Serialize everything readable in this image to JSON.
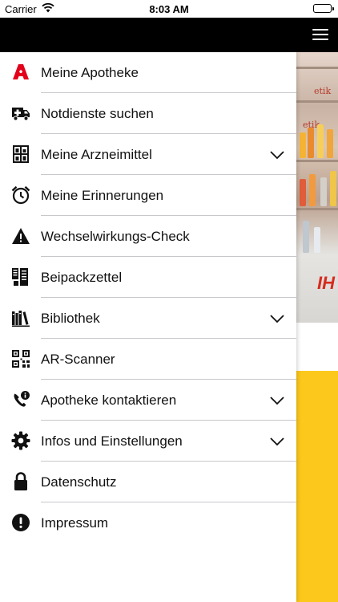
{
  "status_bar": {
    "carrier": "Carrier",
    "time": "8:03 AM",
    "battery_level": 1.0
  },
  "nav_bar": {
    "menu_icon": "hamburger-icon"
  },
  "background": {
    "brand_text_1": "etik",
    "brand_text_2": "etik",
    "promo_text": "IH",
    "accent_color": "#fcc81b"
  },
  "menu": {
    "items": [
      {
        "label": "Meine Apotheke",
        "icon": "pharmacy-icon",
        "icon_color": "#e3001b",
        "has_chevron": false
      },
      {
        "label": "Notdienste suchen",
        "icon": "ambulance-icon",
        "has_chevron": false
      },
      {
        "label": "Meine Arzneimittel",
        "icon": "medicine-cabinet-icon",
        "has_chevron": true
      },
      {
        "label": "Meine Erinnerungen",
        "icon": "alarm-clock-icon",
        "has_chevron": false
      },
      {
        "label": "Wechselwirkungs-Check",
        "icon": "warning-icon",
        "has_chevron": false
      },
      {
        "label": "Beipackzettel",
        "icon": "leaflet-icon",
        "has_chevron": false
      },
      {
        "label": "Bibliothek",
        "icon": "library-icon",
        "has_chevron": true
      },
      {
        "label": "AR-Scanner",
        "icon": "qr-code-icon",
        "has_chevron": false
      },
      {
        "label": "Apotheke kontaktieren",
        "icon": "phone-info-icon",
        "has_chevron": true
      },
      {
        "label": "Infos und Einstellungen",
        "icon": "gear-icon",
        "has_chevron": true
      },
      {
        "label": "Datenschutz",
        "icon": "lock-icon",
        "has_chevron": false
      },
      {
        "label": "Impressum",
        "icon": "info-exclamation-icon",
        "has_chevron": false
      }
    ]
  }
}
